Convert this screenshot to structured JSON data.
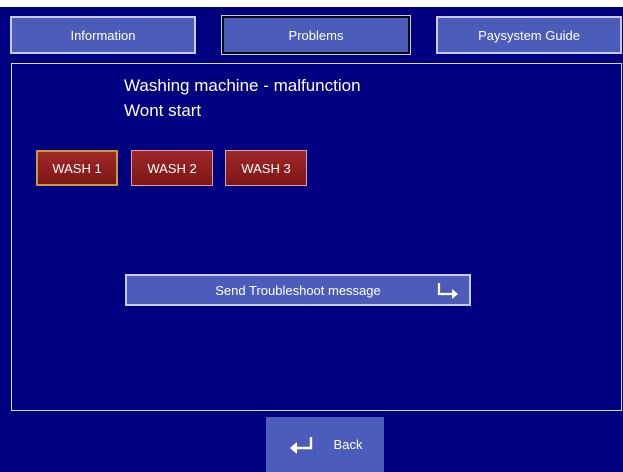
{
  "tabs": [
    {
      "label": "Information",
      "active": false
    },
    {
      "label": "Problems",
      "active": true
    },
    {
      "label": "Paysystem Guide",
      "active": false
    }
  ],
  "problem": {
    "title": "Washing machine - malfunction",
    "subtitle": "Wont start"
  },
  "machines": [
    {
      "label": "WASH 1",
      "selected": true
    },
    {
      "label": "WASH 2",
      "selected": false
    },
    {
      "label": "WASH 3",
      "selected": false
    }
  ],
  "send_button": {
    "label": "Send Troubleshoot message",
    "icon": "enter-arrow-icon"
  },
  "back_button": {
    "label": "Back",
    "icon": "return-arrow-icon"
  },
  "colors": {
    "background": "#000080",
    "button_blue": "#4c5cbb",
    "button_red": "#8e1e1e",
    "text": "#ffffff"
  }
}
